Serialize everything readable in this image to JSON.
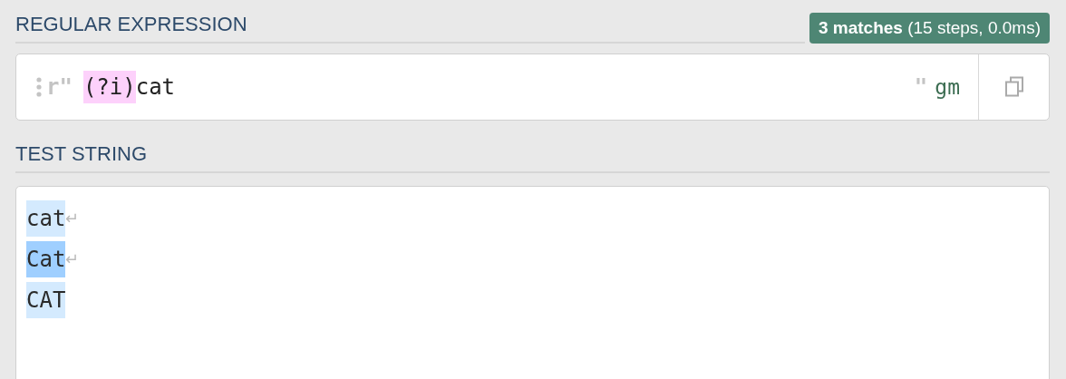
{
  "regex_section": {
    "title": "REGULAR EXPRESSION",
    "match_info": "**3 matches** (15 steps, 0.0ms)",
    "editor": {
      "open_delimiter": "r\"",
      "tokens": [
        {
          "text": "(?i)",
          "kind": "group"
        },
        {
          "text": "cat",
          "kind": "literal"
        }
      ],
      "close_delimiter": "\"",
      "flags": "gm"
    }
  },
  "test_section": {
    "title": "TEST STRING",
    "lines": [
      {
        "text": "cat",
        "selected": false,
        "line_end": "↵"
      },
      {
        "text": "Cat",
        "selected": true,
        "line_end": "↵"
      },
      {
        "text": "CAT",
        "selected": false
      }
    ]
  }
}
